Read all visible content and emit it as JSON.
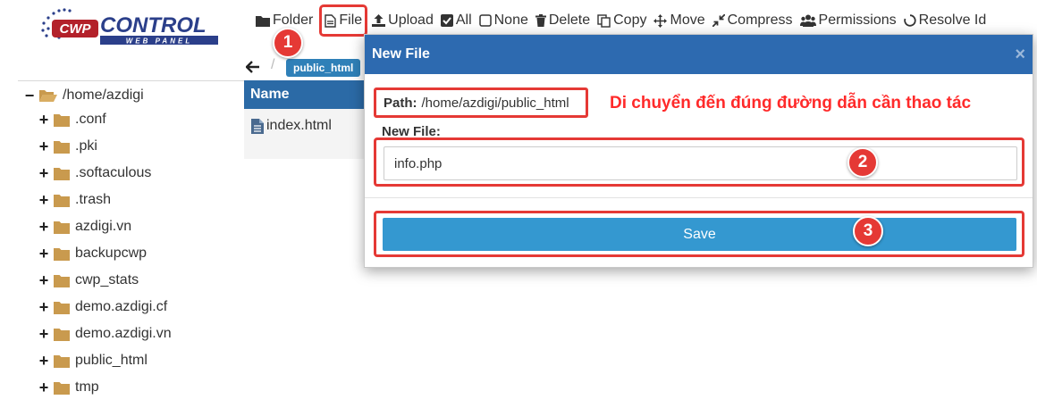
{
  "brand": {
    "logo_main": "CONTROL",
    "logo_sub": "WEB PANEL",
    "logo_prefix": "CWP"
  },
  "toolbar": [
    {
      "label": "Folder",
      "icon": "folder-icon"
    },
    {
      "label": "File",
      "icon": "file-icon"
    },
    {
      "label": "Upload",
      "icon": "upload-icon"
    },
    {
      "label": "All",
      "icon": "checkbox-checked-icon"
    },
    {
      "label": "None",
      "icon": "checkbox-empty-icon"
    },
    {
      "label": "Delete",
      "icon": "trash-icon"
    },
    {
      "label": "Copy",
      "icon": "copy-icon"
    },
    {
      "label": "Move",
      "icon": "move-icon"
    },
    {
      "label": "Compress",
      "icon": "compress-icon"
    },
    {
      "label": "Permissions",
      "icon": "users-icon"
    },
    {
      "label": "Resolve Id",
      "icon": "spinner-icon"
    }
  ],
  "badges": [
    "1",
    "2",
    "3"
  ],
  "breadcrumb": {
    "current": "public_html"
  },
  "tree": {
    "root": "/home/azdigi",
    "items": [
      ".conf",
      ".pki",
      ".softaculous",
      ".trash",
      "azdigi.vn",
      "backupcwp",
      "cwp_stats",
      "demo.azdigi.cf",
      "demo.azdigi.vn",
      "public_html",
      "tmp"
    ]
  },
  "file_table": {
    "header": "Name",
    "rows": [
      "index.html"
    ]
  },
  "modal": {
    "title": "New File",
    "close": "×",
    "path_label": "Path:",
    "path_value": "/home/azdigi/public_html",
    "annotation": "Di chuyển đến đúng đường dẫn cần thao tác",
    "new_file_label": "New File:",
    "new_file_value": "info.php",
    "save_label": "Save"
  },
  "colors": {
    "accent": "#2d6ab0",
    "save": "#3498d0",
    "highlight": "#e53935",
    "folder": "#c99a4e"
  }
}
